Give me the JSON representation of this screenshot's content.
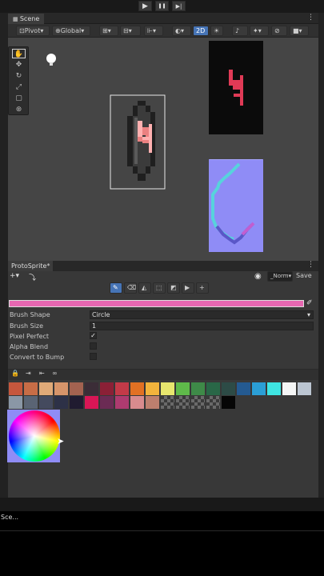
{
  "playbar": {
    "play": "▶",
    "pause": "❚❚",
    "step": "▶|"
  },
  "scene_tab": {
    "label": "Scene",
    "menu": "⋮"
  },
  "toolbar": {
    "pivot": "Pivot",
    "global": "Global",
    "mode_2d": "2D"
  },
  "panel": {
    "title": "ProtoSprite*",
    "layer_select": "_Norm",
    "save": "Save",
    "menu": "⋮",
    "brush_color": "#e667b1",
    "properties": [
      {
        "label": "Brush Shape",
        "value": "Circle"
      },
      {
        "label": "Brush Size",
        "value": "1"
      },
      {
        "label": "Pixel Perfect",
        "checked": true
      },
      {
        "label": "Alpha Blend",
        "checked": false
      },
      {
        "label": "Convert to Bump",
        "checked": false
      }
    ],
    "palette_row1": [
      "#c6573d",
      "#c86d46",
      "#e0aa78",
      "#d7956a",
      "#a36250",
      "#3b2d37",
      "#8b2036",
      "#c33a48",
      "#e27123",
      "#f3b43c",
      "#e7e66e",
      "#5fba4a",
      "#3e8a48",
      "#296747",
      "#2d4b46",
      "#245a91",
      "#2b9fd6",
      "#3fe5e2",
      "#f5f6f6",
      "#bcc6d2"
    ],
    "palette_row2": [
      "#8a97a6",
      "#5a6474",
      "#444a5e",
      "#2d3147",
      "#201b30",
      "#d91656",
      "#6b2b54",
      "#ae3b70",
      "#d88b8e",
      "#bd7f6e",
      "#checker",
      "#checker",
      "#checker",
      "#checker",
      "#060606"
    ]
  },
  "status": {
    "text": "Sce..."
  }
}
